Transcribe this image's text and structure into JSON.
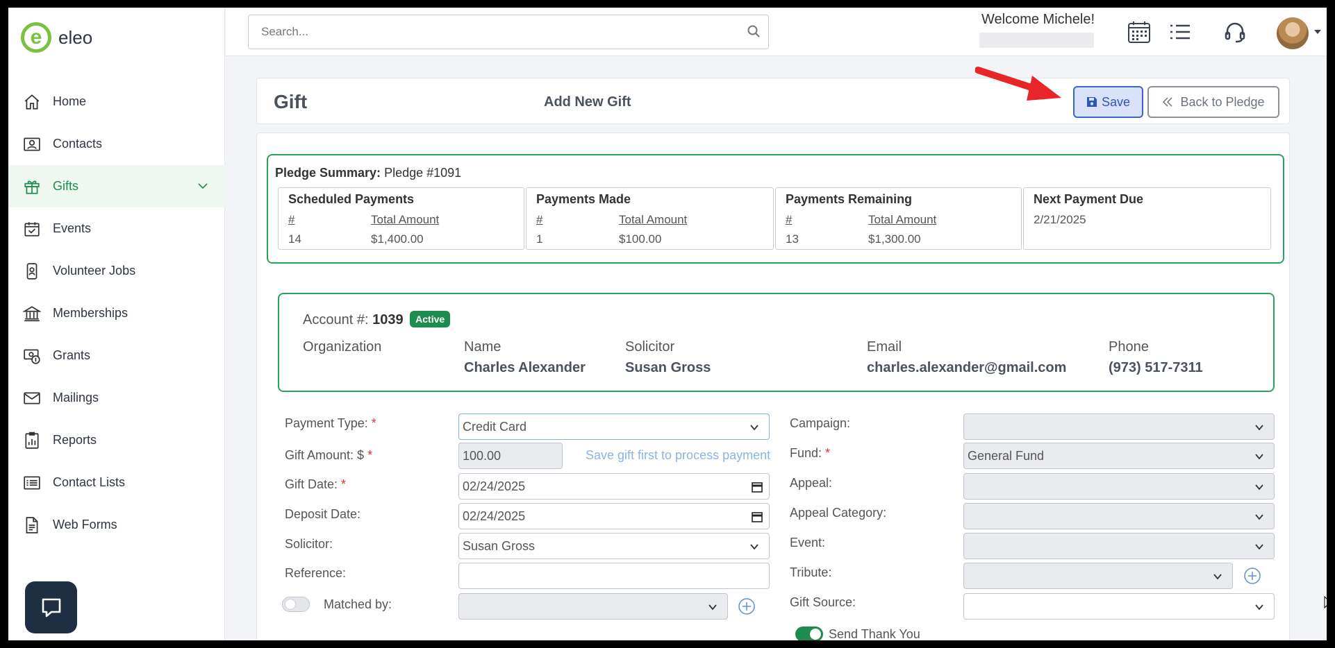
{
  "app": {
    "logo_text": "eleo"
  },
  "sidebar": {
    "items": [
      {
        "label": "Home",
        "icon": "home-icon"
      },
      {
        "label": "Contacts",
        "icon": "contacts-icon"
      },
      {
        "label": "Gifts",
        "icon": "gift-icon",
        "active": true
      },
      {
        "label": "Events",
        "icon": "calendar-check-icon"
      },
      {
        "label": "Volunteer Jobs",
        "icon": "badge-icon"
      },
      {
        "label": "Memberships",
        "icon": "bank-icon"
      },
      {
        "label": "Grants",
        "icon": "money-icon"
      },
      {
        "label": "Mailings",
        "icon": "envelope-icon"
      },
      {
        "label": "Reports",
        "icon": "report-icon"
      },
      {
        "label": "Contact Lists",
        "icon": "list-icon"
      },
      {
        "label": "Web Forms",
        "icon": "document-icon"
      }
    ]
  },
  "header": {
    "search_placeholder": "Search...",
    "welcome": "Welcome Michele!"
  },
  "page": {
    "title": "Gift",
    "subtitle": "Add New Gift",
    "save_label": "Save",
    "back_label": "Back to Pledge"
  },
  "pledge": {
    "label": "Pledge Summary:",
    "value": "Pledge #1091",
    "scheduled": {
      "title": "Scheduled Payments",
      "h1": "#",
      "h2": "Total Amount",
      "count": "14",
      "amount": "$1,400.00"
    },
    "made": {
      "title": "Payments Made",
      "h1": "#",
      "h2": "Total Amount",
      "count": "1",
      "amount": "$100.00"
    },
    "remaining": {
      "title": "Payments Remaining",
      "h1": "#",
      "h2": "Total Amount",
      "count": "13",
      "amount": "$1,300.00"
    },
    "next": {
      "title": "Next Payment Due",
      "date": "2/21/2025"
    }
  },
  "account": {
    "label": "Account #:",
    "number": "1039",
    "status": "Active",
    "org_label": "Organization",
    "name_label": "Name",
    "name": "Charles Alexander",
    "solicitor_label": "Solicitor",
    "solicitor": "Susan Gross",
    "email_label": "Email",
    "email": "charles.alexander@gmail.com",
    "phone_label": "Phone",
    "phone": "(973) 517-7311"
  },
  "form": {
    "payment_type_label": "Payment Type:",
    "payment_type": "Credit Card",
    "gift_amount_label": "Gift Amount: $",
    "gift_amount": "100.00",
    "gift_amount_hint": "Save gift first to process payment",
    "gift_date_label": "Gift Date:",
    "gift_date": "02/24/2025",
    "deposit_date_label": "Deposit Date:",
    "deposit_date": "02/24/2025",
    "solicitor_label": "Solicitor:",
    "solicitor": "Susan Gross",
    "reference_label": "Reference:",
    "reference": "",
    "matched_by_label": "Matched by:",
    "campaign_label": "Campaign:",
    "fund_label": "Fund:",
    "fund": "General Fund",
    "appeal_label": "Appeal:",
    "appeal_category_label": "Appeal Category:",
    "event_label": "Event:",
    "tribute_label": "Tribute:",
    "gift_source_label": "Gift Source:",
    "send_thank_you_label": "Send Thank You",
    "required_mark": "*"
  },
  "colors": {
    "brand_green": "#1e8c4e",
    "logo_green": "#7ac142",
    "save_blue": "#2c56b8",
    "annotation_red": "#e8262a"
  }
}
